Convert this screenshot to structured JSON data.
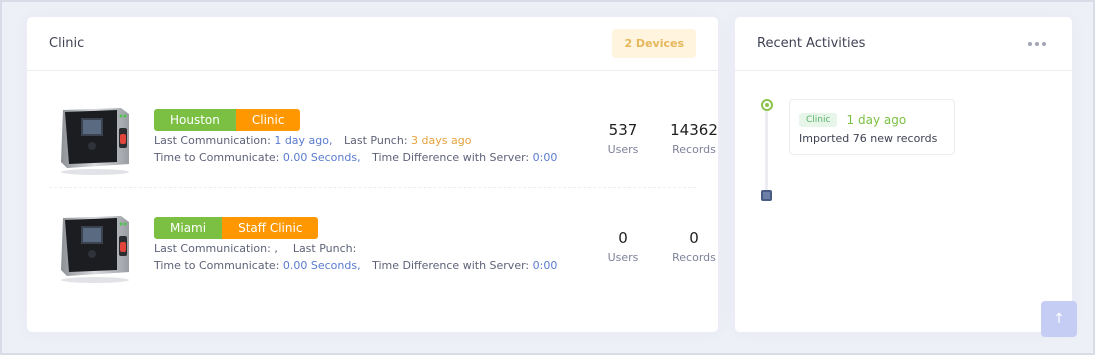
{
  "clinic_card": {
    "title": "Clinic",
    "devices_badge": "2 Devices",
    "devices": [
      {
        "location": "Houston",
        "name": "Clinic",
        "last_comm_label": "Last Communication:",
        "last_comm_value": "1 day ago,",
        "last_punch_label": "Last Punch:",
        "last_punch_value": "3 days ago",
        "time_comm_label": "Time to Communicate:",
        "time_comm_value": "0.00 Seconds,",
        "time_diff_label": "Time Difference with Server:",
        "time_diff_value": "0:00",
        "users_count": "537",
        "users_label": "Users",
        "records_count": "14362",
        "records_label": "Records"
      },
      {
        "location": "Miami",
        "name": "Staff Clinic",
        "last_comm_label": "Last Communication: ,",
        "last_comm_value": "",
        "last_punch_label": "Last Punch:",
        "last_punch_value": "",
        "time_comm_label": "Time to Communicate:",
        "time_comm_value": "0.00 Seconds,",
        "time_diff_label": "Time Difference with Server:",
        "time_diff_value": "0:00",
        "users_count": "0",
        "users_label": "Users",
        "records_count": "0",
        "records_label": "Records"
      }
    ]
  },
  "activities_card": {
    "title": "Recent Activities",
    "menu_icon": "more-horizontal-icon",
    "items": [
      {
        "tag": "Clinic",
        "time": "1 day ago",
        "text": "Imported 76 new records"
      }
    ]
  },
  "scroll_top_icon": "arrow-up-icon",
  "colors": {
    "location_badge": "#7bc043",
    "name_badge": "#ff9800",
    "link_blue": "#5a7bd0",
    "accent_orange": "#e6a23c"
  }
}
